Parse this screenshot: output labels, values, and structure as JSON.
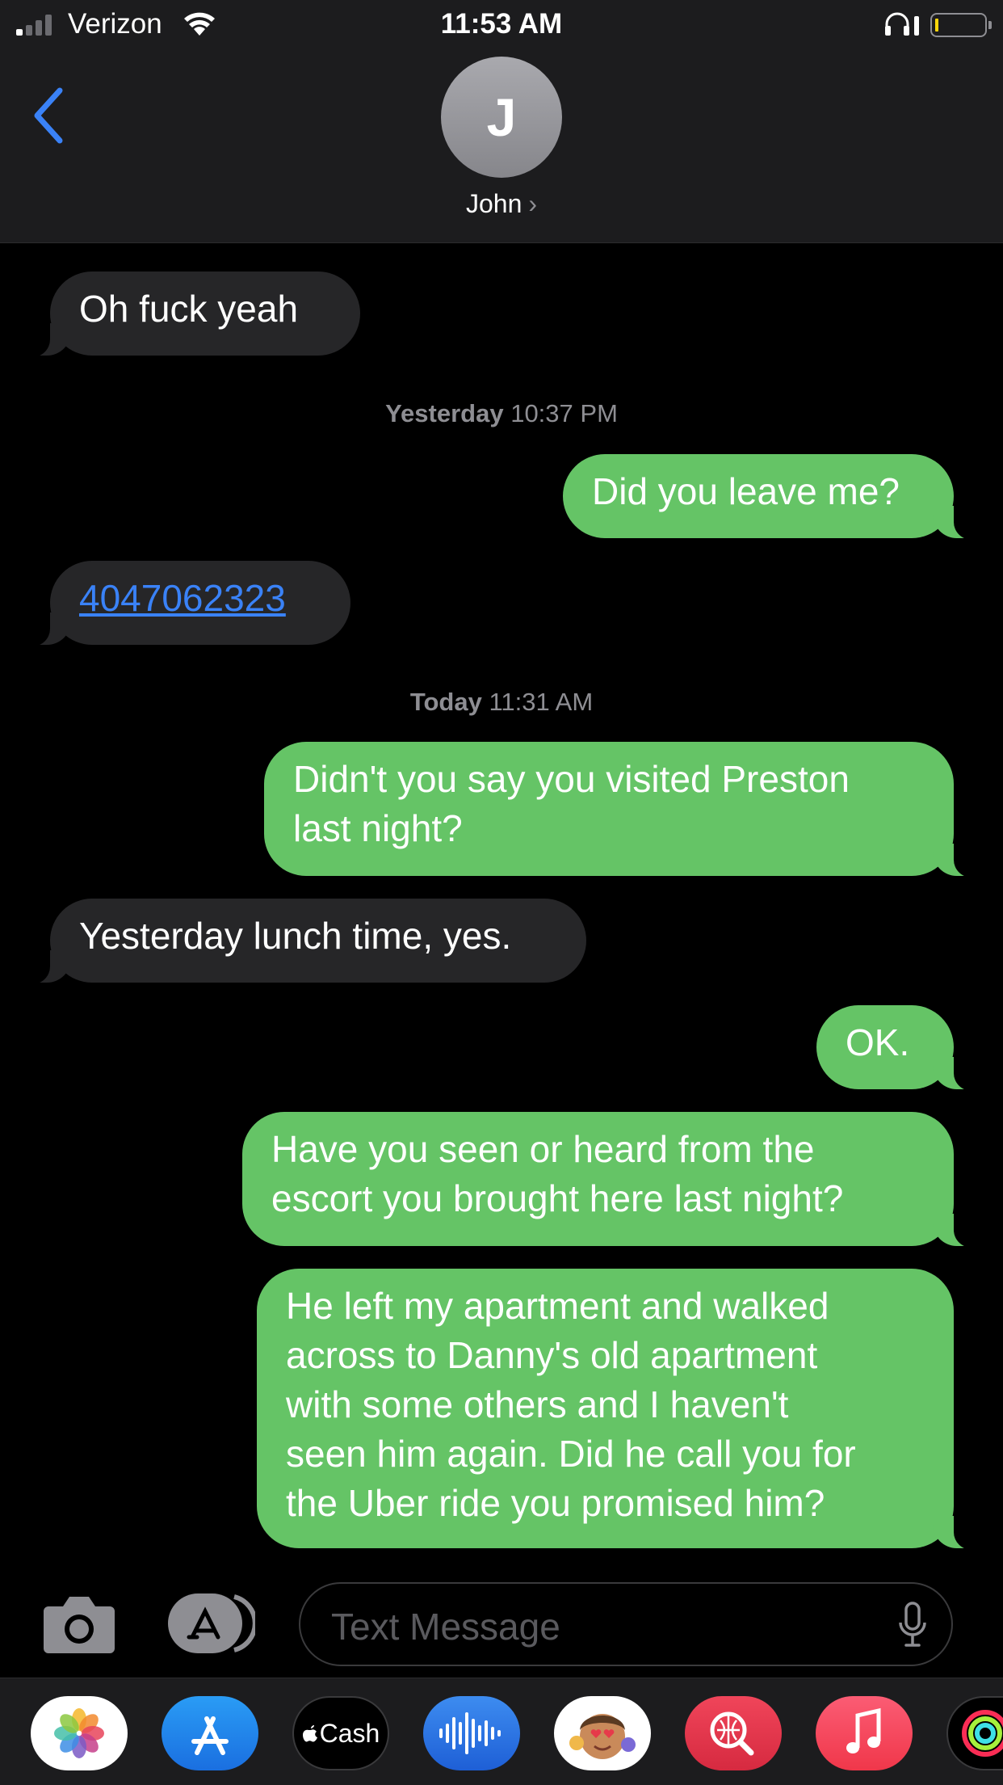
{
  "status": {
    "carrier": "Verizon",
    "time": "11:53 AM"
  },
  "contact": {
    "initial": "J",
    "name": "John"
  },
  "messages": [
    {
      "type": "in",
      "text": "Oh fuck yeah"
    },
    {
      "type": "timestamp",
      "day": "Yesterday",
      "time": "10:37 PM"
    },
    {
      "type": "out",
      "text": "Did you leave me?"
    },
    {
      "type": "in",
      "text": "4047062323",
      "is_link": true
    },
    {
      "type": "timestamp",
      "day": "Today",
      "time": "11:31 AM"
    },
    {
      "type": "out",
      "lines": [
        "Didn't you say you visited Preston",
        "last night?"
      ]
    },
    {
      "type": "in",
      "text": "Yesterday lunch time, yes."
    },
    {
      "type": "out",
      "text": "OK."
    },
    {
      "type": "out",
      "lines": [
        "Have you seen or heard from the",
        "escort you brought here last night?"
      ]
    },
    {
      "type": "out",
      "lines": [
        "He left my apartment and walked",
        "across to Danny's old apartment",
        "with some others and I haven't",
        "seen him again. Did he call you for",
        "the Uber ride you promised him?"
      ]
    }
  ],
  "composer": {
    "placeholder": "Text Message"
  },
  "apps": [
    "photos",
    "app-store",
    "apple-cash",
    "audio-message",
    "memoji",
    "image-search",
    "music",
    "activity"
  ],
  "apps_labels": {
    "cash": "Cash"
  },
  "colors": {
    "outgoing": "#65c466",
    "incoming": "#262628",
    "accent": "#3a82f7"
  }
}
